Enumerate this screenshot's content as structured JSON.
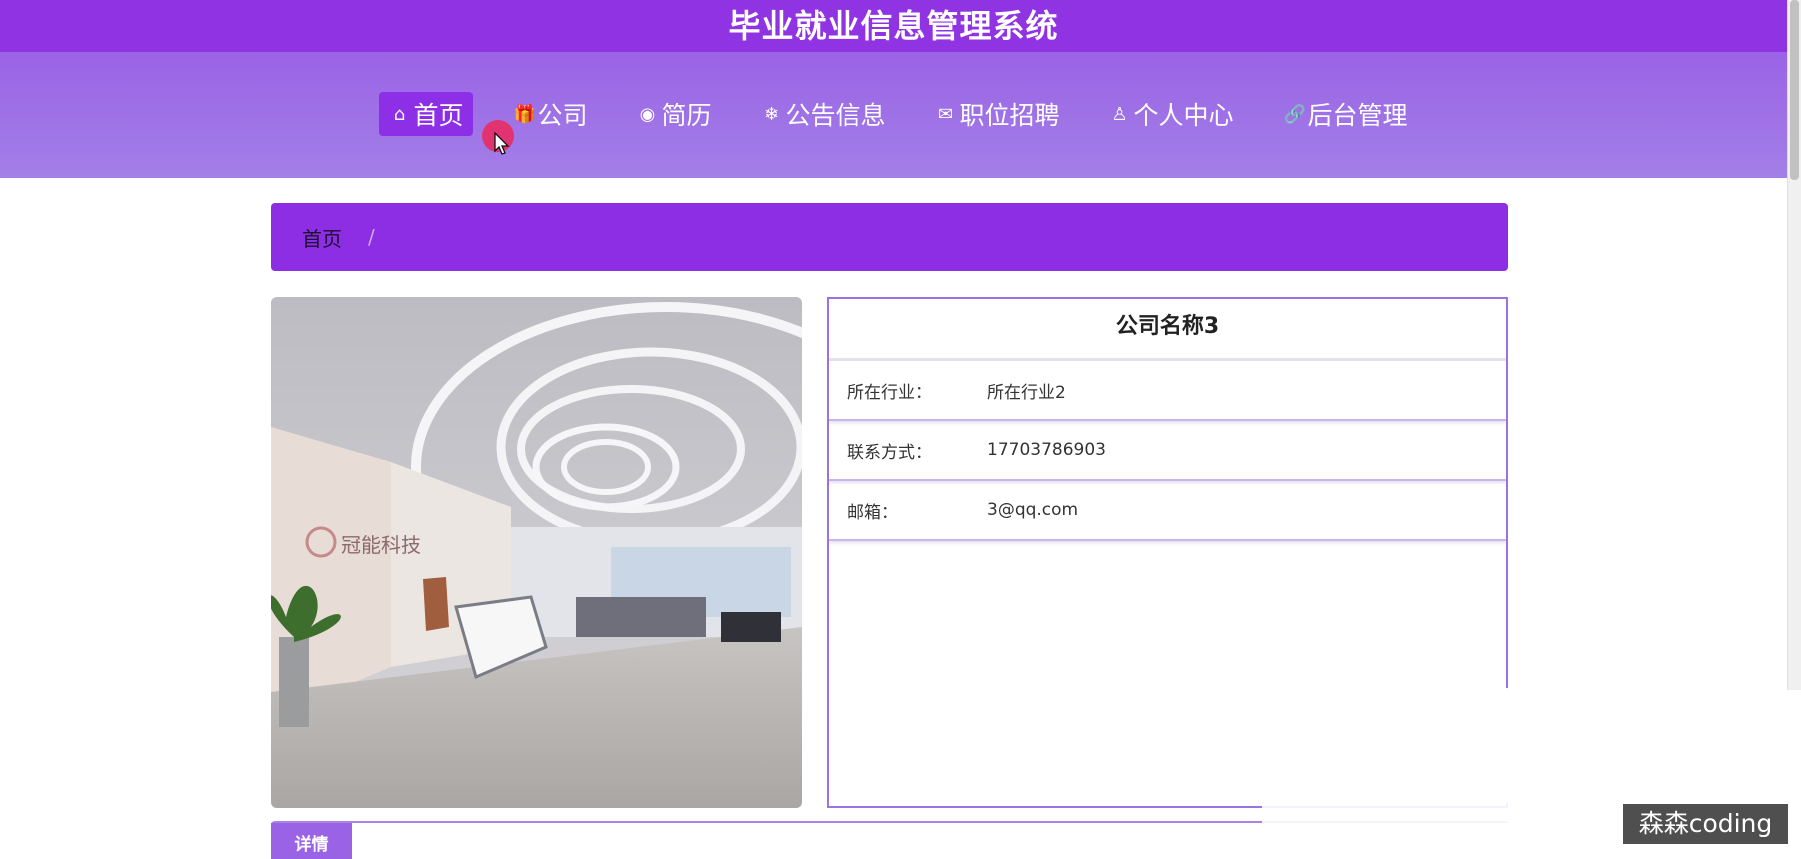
{
  "header": {
    "title": "毕业就业信息管理系统"
  },
  "nav": {
    "items": [
      {
        "label": "首页",
        "icon": "home-icon",
        "glyph": "⌂",
        "active": true
      },
      {
        "label": "公司",
        "icon": "gift-icon",
        "glyph": "🎁",
        "active": false
      },
      {
        "label": "简历",
        "icon": "palette-icon",
        "glyph": "◉",
        "active": false
      },
      {
        "label": "公告信息",
        "icon": "snowflake-icon",
        "glyph": "❄",
        "active": false
      },
      {
        "label": "职位招聘",
        "icon": "mail-icon",
        "glyph": "✉",
        "active": false
      },
      {
        "label": "个人中心",
        "icon": "user-icon",
        "glyph": "♙",
        "active": false
      },
      {
        "label": "后台管理",
        "icon": "link-icon",
        "glyph": "🔗",
        "active": false
      }
    ]
  },
  "breadcrumb": {
    "home": "首页",
    "separator": "/"
  },
  "company": {
    "name": "公司名称3",
    "fields": [
      {
        "label": "所在行业：",
        "value": "所在行业2"
      },
      {
        "label": "联系方式：",
        "value": "17703786903"
      },
      {
        "label": "邮箱：",
        "value": "3@qq.com"
      }
    ],
    "image_logo_text": "冠能科技"
  },
  "detail": {
    "tab_label": "详情"
  },
  "watermark": {
    "text": "森森coding"
  },
  "colors": {
    "primary": "#8f33e3",
    "nav_bg": "#a37fe7",
    "border": "#9a73e0"
  }
}
